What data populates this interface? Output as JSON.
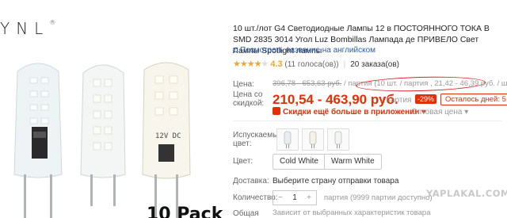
{
  "brand": {
    "logo_text": "YNL",
    "logo_mark": "®"
  },
  "image": {
    "pack_text": "10 Pack",
    "bulb3_label": "12V  DC"
  },
  "product": {
    "title": "10 шт./лот G4 Светодиодные Лампы 12 в ПОСТОЯННОГО ТОКА В SMD 2835 3014 Угол Luz Bombillas Лампада де ПРИВЕЛО Свет Лампы Spotlight лампы",
    "translate_link": "Посмотреть название на английском"
  },
  "rating": {
    "stars": 4.3,
    "value_text": "4.3",
    "votes": "(11 голоса(ов))",
    "orders": "20 заказа(ов)"
  },
  "price": {
    "label": "Цена:",
    "old_range": "396,78 - 653,63 руб.",
    "old_per_lot": "/ партия",
    "old_unit_note": "(10 шт. / партия , 21,42 - 46,39 руб. / шт. )",
    "sale_label_1": "Цена со",
    "sale_label_2": "скидкой:",
    "sale_range": "210,54 - 463,90 руб.",
    "sale_per_lot": "/ партия",
    "discount_badge": "-29%",
    "days_left": "Осталось дней: 5",
    "app_discount": "Скидки ещё больше в приложении",
    "wholesale": "Оптовая цена"
  },
  "options": {
    "color_label_1": "Испускаемый",
    "color_label_2": "цвет:",
    "light_label": "Цвет:",
    "light_options": [
      "Cold White",
      "Warm White"
    ],
    "shipping_label": "Доставка:",
    "shipping_value": "Выберите страну отправки товара",
    "qty_label": "Количество:",
    "qty_minus": "−",
    "qty_value": "1",
    "qty_plus": "+",
    "qty_note": "партия (9999 партии доступно)",
    "total_label": "Общая",
    "total_note": "Зависит от выбранных характеристик товара"
  },
  "watermark": "YAPLAKAL.COM",
  "colors": {
    "accent": "#e62e04",
    "link": "#2a5db0",
    "star": "#f5a623"
  }
}
